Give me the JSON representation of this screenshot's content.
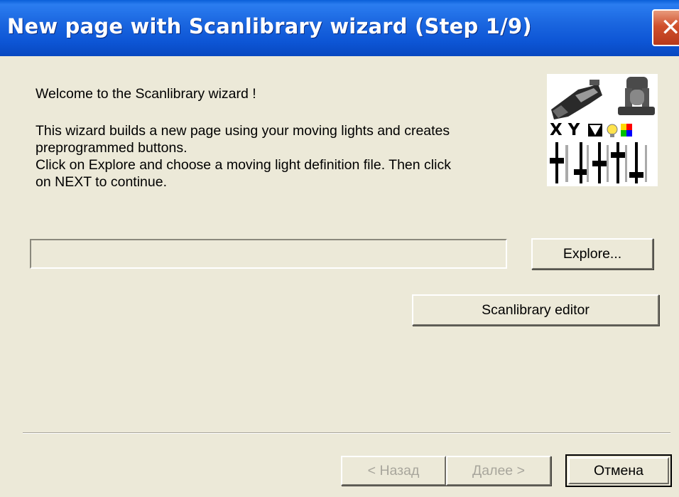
{
  "window": {
    "title": "New page with Scanlibrary wizard (Step 1/9)"
  },
  "content": {
    "welcome": "Welcome to the Scanlibrary wizard !",
    "description_lines": [
      "This wizard builds a new page using your moving lights and creates",
      "preprogrammed buttons.",
      "Click on Explore and choose a moving light definition file. Then click",
      "on NEXT to continue."
    ],
    "file_path_value": ""
  },
  "logo": {
    "letters": "X Y",
    "icon": "moving-lights-logo"
  },
  "buttons": {
    "explore": "Explore...",
    "scanlibrary_editor": "Scanlibrary editor",
    "back": "< Назад",
    "next": "Далее >",
    "cancel": "Отмена"
  },
  "colors": {
    "titlebar": "#0d55d5",
    "face": "#ece9d8",
    "close": "#d0502c"
  }
}
